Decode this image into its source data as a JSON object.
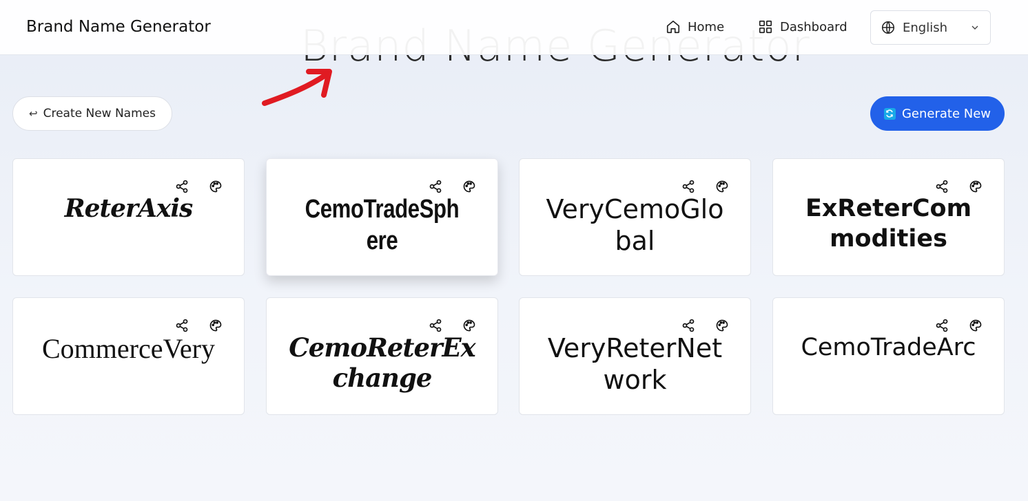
{
  "header": {
    "brand": "Brand Name Generator",
    "nav": {
      "home": "Home",
      "dashboard": "Dashboard"
    },
    "language": "English"
  },
  "hero_title": "Brand Name Generator",
  "actions": {
    "create_new": "Create New Names",
    "generate_new": "Generate New"
  },
  "cards": [
    {
      "name": "ReterAxis"
    },
    {
      "name": "CemoTradeSphere"
    },
    {
      "name": "VeryCemoGlobal"
    },
    {
      "name": "ExReterCommodities"
    },
    {
      "name": "CommerceVery"
    },
    {
      "name": "CemoReterExchange"
    },
    {
      "name": "VeryReterNetwork"
    },
    {
      "name": "CemoTradeArc"
    }
  ],
  "colors": {
    "accent": "#2261e9",
    "annotation_arrow": "#e01b22",
    "background": "#eef1f8"
  },
  "icons": {
    "card_actions": [
      "share-icon",
      "palette-icon"
    ],
    "nav": [
      "home-icon",
      "dashboard-icon",
      "globe-icon",
      "chevron-down-icon"
    ]
  }
}
